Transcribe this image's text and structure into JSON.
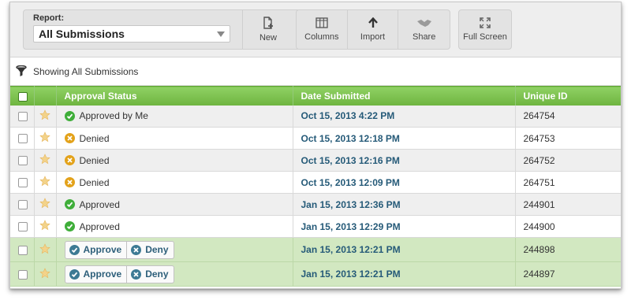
{
  "toolbar": {
    "report_label": "Report:",
    "report_value": "All Submissions",
    "buttons": {
      "new": "New",
      "columns": "Columns",
      "import": "Import",
      "share": "Share",
      "fullscreen": "Full Screen"
    }
  },
  "filter": {
    "icon": "filter-icon",
    "text": "Showing All Submissions"
  },
  "table": {
    "headers": {
      "status": "Approval Status",
      "date": "Date Submitted",
      "id": "Unique ID"
    },
    "rows": [
      {
        "status": "Approved by Me",
        "status_type": "approved",
        "date": "Oct 15, 2013 4:22 PM",
        "id": "264754"
      },
      {
        "status": "Denied",
        "status_type": "denied",
        "date": "Oct 15, 2013 12:18 PM",
        "id": "264753"
      },
      {
        "status": "Denied",
        "status_type": "denied",
        "date": "Oct 15, 2013 12:16 PM",
        "id": "264752"
      },
      {
        "status": "Denied",
        "status_type": "denied",
        "date": "Oct 15, 2013 12:09 PM",
        "id": "264751"
      },
      {
        "status": "Approved",
        "status_type": "approved",
        "date": "Jan 15, 2013 12:36 PM",
        "id": "244901"
      },
      {
        "status": "Approved",
        "status_type": "approved",
        "date": "Jan 15, 2013 12:29 PM",
        "id": "244900"
      },
      {
        "status": "",
        "status_type": "pending",
        "approve_label": "Approve",
        "deny_label": "Deny",
        "date": "Jan 15, 2013 12:21 PM",
        "id": "244898"
      },
      {
        "status": "",
        "status_type": "pending",
        "approve_label": "Approve",
        "deny_label": "Deny",
        "date": "Jan 15, 2013 12:21 PM",
        "id": "244897"
      }
    ]
  },
  "colors": {
    "header_green": "#7cc24f",
    "pending_row": "#d2e8c1",
    "date_blue": "#255a78",
    "approved_green": "#3fae3a",
    "denied_orange": "#e3a21a",
    "star": "#f3d38a"
  }
}
